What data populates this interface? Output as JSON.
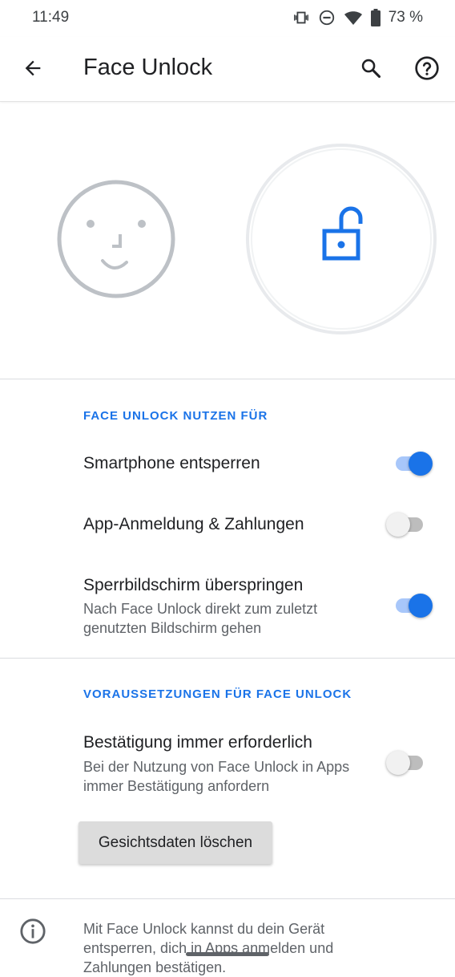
{
  "status_bar": {
    "time": "11:49",
    "battery_text": "73 %",
    "icons": [
      "vibrate-icon",
      "do-not-disturb-icon",
      "wifi-icon",
      "battery-icon"
    ]
  },
  "app_bar": {
    "title": "Face Unlock",
    "icons": [
      "arrow-back-icon",
      "search-icon",
      "help-icon"
    ]
  },
  "hero": {
    "icons": [
      "face-icon",
      "unlock-icon"
    ],
    "accent_color": "#1a73e8",
    "face_color": "#bdc1c6"
  },
  "section_use": {
    "header": "FACE UNLOCK NUTZEN FÜR",
    "items": [
      {
        "title": "Smartphone entsperren",
        "summary": "",
        "checked": true
      },
      {
        "title": "App-Anmeldung & Zahlungen",
        "summary": "",
        "checked": false
      },
      {
        "title": "Sperrbildschirm überspringen",
        "summary": "Nach Face Unlock direkt zum zuletzt genutzten Bildschirm gehen",
        "checked": true
      }
    ]
  },
  "section_requirements": {
    "header": "VORAUSSETZUNGEN FÜR FACE UNLOCK",
    "items": [
      {
        "title": "Bestätigung immer erforderlich",
        "summary": "Bei der Nutzung von Face Unlock in Apps immer Bestätigung anfordern",
        "checked": false
      }
    ],
    "delete_button": "Gesichtsdaten löschen"
  },
  "footer": {
    "text": "Mit Face Unlock kannst du dein Gerät entsperren, dich in Apps anmelden und Zahlungen bestätigen.",
    "icon": "info-icon"
  }
}
